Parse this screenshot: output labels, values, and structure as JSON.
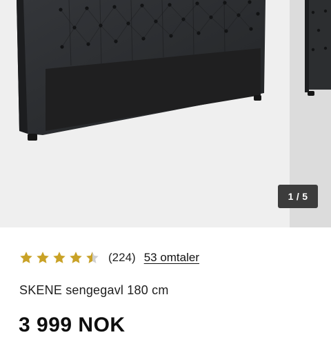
{
  "gallery": {
    "counter": "1 / 5",
    "colors": {
      "background": "#efefef",
      "peek_background": "#dcdcdc",
      "headboard": "#2a2b2c"
    }
  },
  "product": {
    "rating": 4.5,
    "rating_count": "(224)",
    "reviews_link": "53 omtaler",
    "title": "SKENE sengegavl 180 cm",
    "price": "3 999 NOK"
  },
  "icons": {
    "star": "star-icon",
    "half_star": "half-star-icon"
  },
  "colors": {
    "star": "#c9a227",
    "star_empty": "#cfcfcf",
    "text": "#1e1e1e"
  }
}
